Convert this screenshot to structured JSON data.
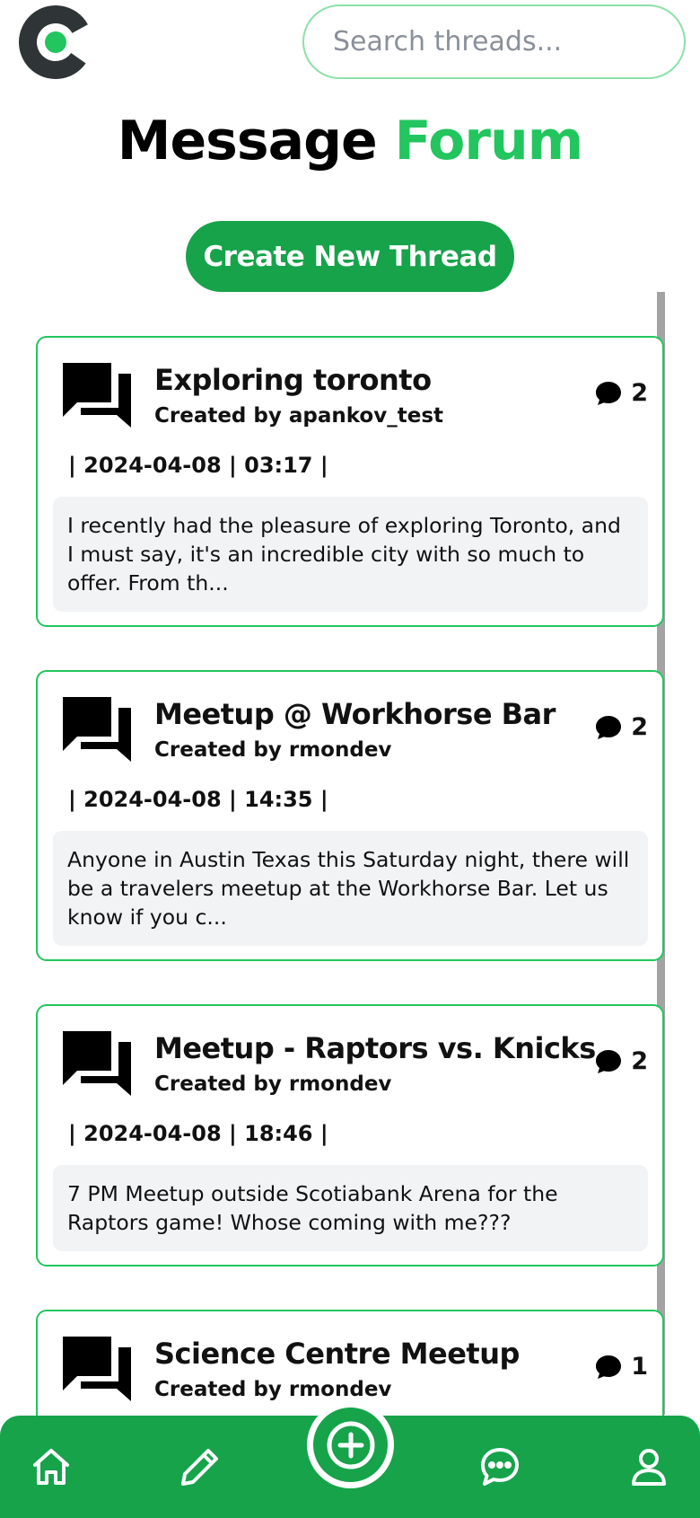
{
  "app": {
    "title_main": "Message",
    "title_accent": "Forum",
    "brand_color": "#16a34a",
    "accent_color": "#22c55e"
  },
  "search": {
    "placeholder": "Search threads..."
  },
  "actions": {
    "create_thread_label": "Create New Thread"
  },
  "threads": [
    {
      "title": "Exploring toronto",
      "author": "Created by apankov_test",
      "meta": "| 2024-04-08 | 03:17 |",
      "replies": "2",
      "preview": "I recently had the pleasure of exploring Toronto, and I must say, it's an incredible city with so much to offer. From th..."
    },
    {
      "title": "Meetup @ Workhorse Bar",
      "author": "Created by rmondev",
      "meta": "| 2024-04-08 | 14:35 |",
      "replies": "2",
      "preview": "Anyone in Austin Texas this Saturday night, there will be a travelers meetup at the Workhorse Bar. Let us know if you c..."
    },
    {
      "title": "Meetup - Raptors vs. Knicks",
      "author": "Created by rmondev",
      "meta": "| 2024-04-08 | 18:46 |",
      "replies": "2",
      "preview": "7 PM Meetup outside Scotiabank Arena for the Raptors game! Whose coming with me???"
    },
    {
      "title": "Science Centre Meetup",
      "author": "Created by rmondev",
      "meta": "",
      "replies": "1",
      "preview": ""
    }
  ],
  "nav": {
    "items": [
      "home-icon",
      "pencil-icon",
      "plus-circle-icon",
      "chat-icon",
      "user-icon"
    ]
  }
}
